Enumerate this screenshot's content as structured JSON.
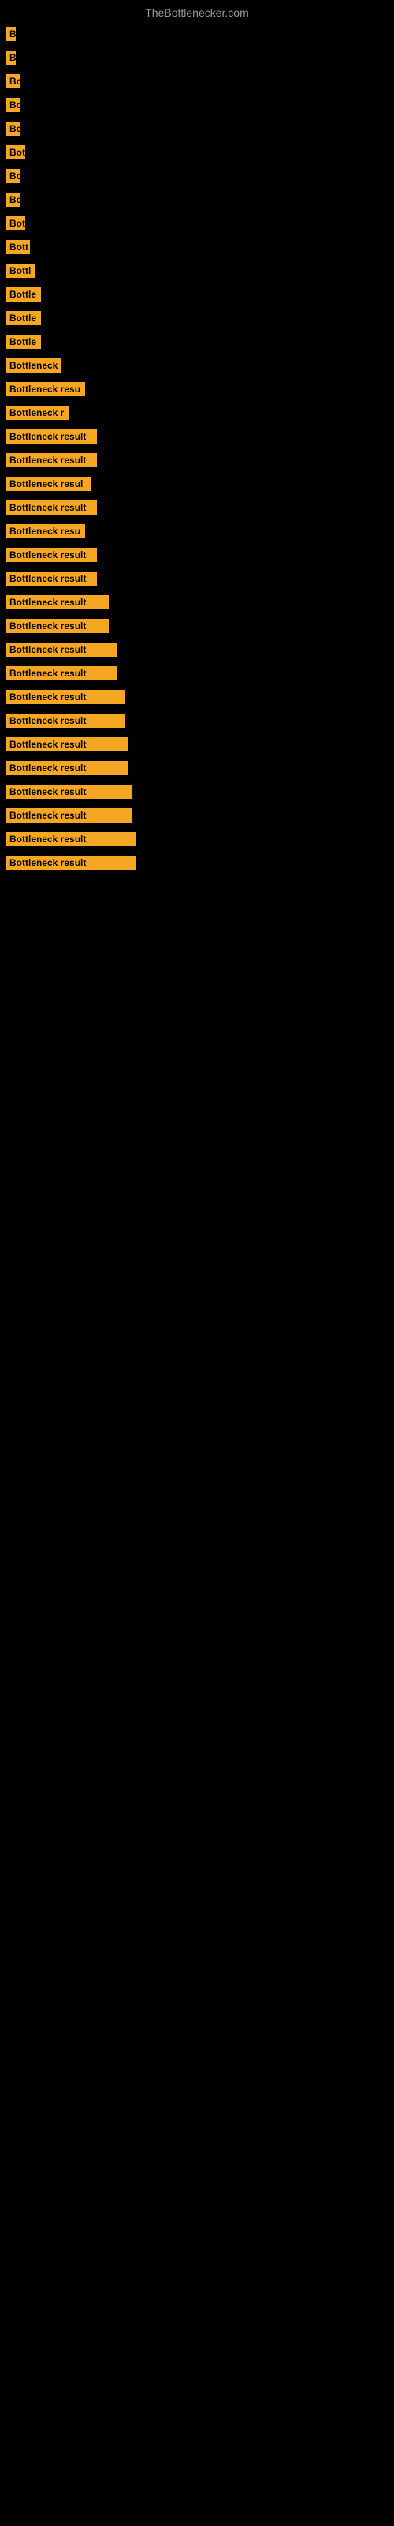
{
  "site_title": "TheBottlenecker.com",
  "items": [
    {
      "label": "B",
      "width": 12
    },
    {
      "label": "B",
      "width": 12
    },
    {
      "label": "Bo",
      "width": 18
    },
    {
      "label": "Bo",
      "width": 18
    },
    {
      "label": "Bo",
      "width": 18
    },
    {
      "label": "Bot",
      "width": 24
    },
    {
      "label": "Bo",
      "width": 18
    },
    {
      "label": "Bo",
      "width": 18
    },
    {
      "label": "Bot",
      "width": 24
    },
    {
      "label": "Bott",
      "width": 30
    },
    {
      "label": "Bottl",
      "width": 36
    },
    {
      "label": "Bottle",
      "width": 44
    },
    {
      "label": "Bottle",
      "width": 44
    },
    {
      "label": "Bottle",
      "width": 44
    },
    {
      "label": "Bottleneck",
      "width": 70
    },
    {
      "label": "Bottleneck resu",
      "width": 100
    },
    {
      "label": "Bottleneck r",
      "width": 80
    },
    {
      "label": "Bottleneck result",
      "width": 115
    },
    {
      "label": "Bottleneck result",
      "width": 115
    },
    {
      "label": "Bottleneck resul",
      "width": 108
    },
    {
      "label": "Bottleneck result",
      "width": 115
    },
    {
      "label": "Bottleneck resu",
      "width": 100
    },
    {
      "label": "Bottleneck result",
      "width": 115
    },
    {
      "label": "Bottleneck result",
      "width": 115
    },
    {
      "label": "Bottleneck result",
      "width": 130
    },
    {
      "label": "Bottleneck result",
      "width": 130
    },
    {
      "label": "Bottleneck result",
      "width": 140
    },
    {
      "label": "Bottleneck result",
      "width": 140
    },
    {
      "label": "Bottleneck result",
      "width": 150
    },
    {
      "label": "Bottleneck result",
      "width": 150
    },
    {
      "label": "Bottleneck result",
      "width": 155
    },
    {
      "label": "Bottleneck result",
      "width": 155
    },
    {
      "label": "Bottleneck result",
      "width": 160
    },
    {
      "label": "Bottleneck result",
      "width": 160
    },
    {
      "label": "Bottleneck result",
      "width": 165
    },
    {
      "label": "Bottleneck result",
      "width": 165
    }
  ]
}
